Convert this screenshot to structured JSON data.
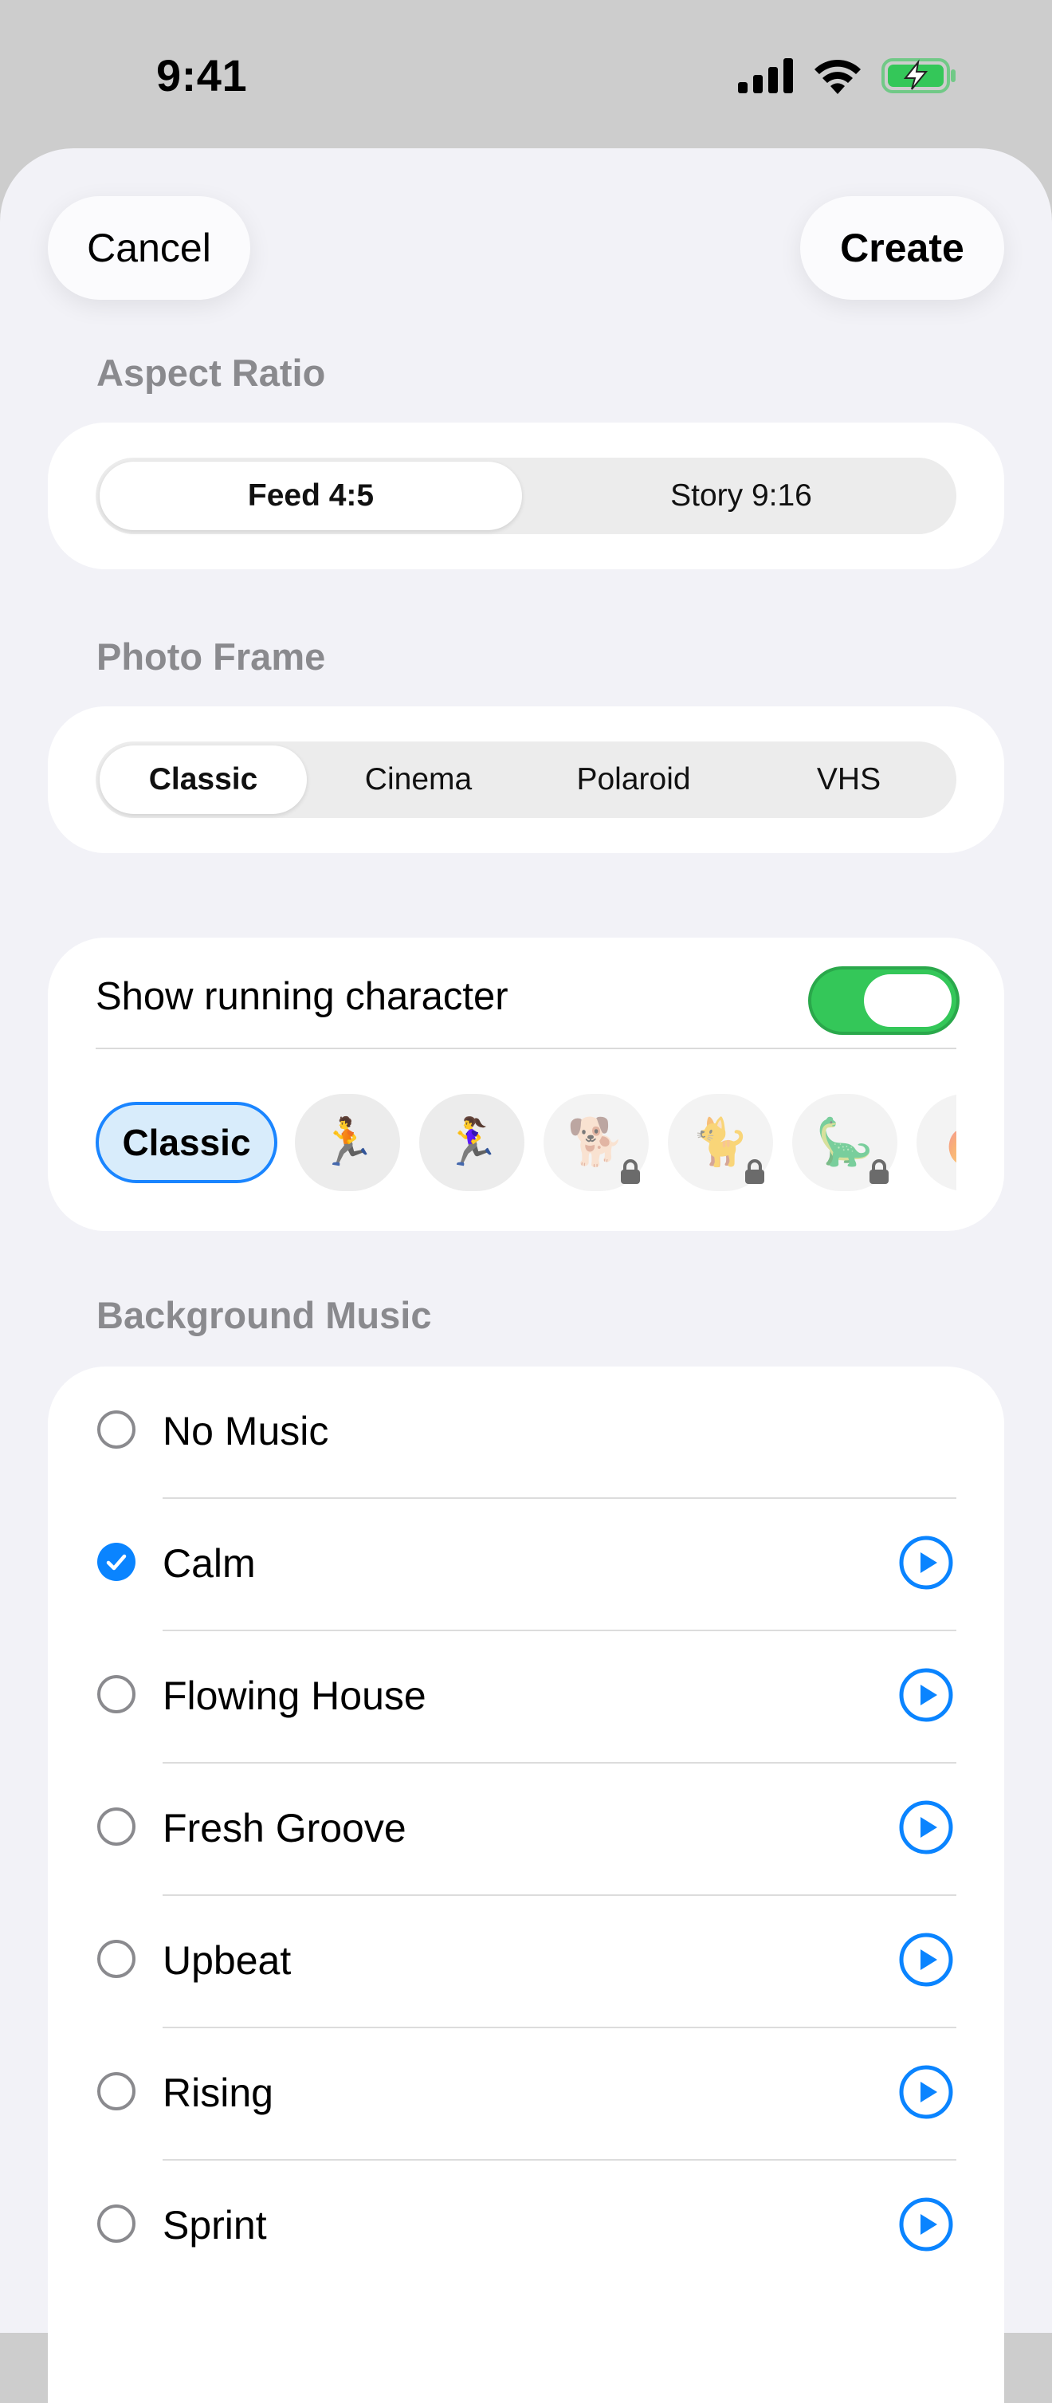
{
  "status_bar": {
    "time": "9:41"
  },
  "header": {
    "cancel_label": "Cancel",
    "create_label": "Create"
  },
  "aspect_ratio": {
    "title": "Aspect Ratio",
    "options": [
      "Feed 4:5",
      "Story 9:16"
    ],
    "selected": "Feed 4:5"
  },
  "photo_frame": {
    "title": "Photo Frame",
    "options": [
      "Classic",
      "Cinema",
      "Polaroid",
      "VHS"
    ],
    "selected": "Classic"
  },
  "character": {
    "label": "Show running character",
    "enabled": true,
    "selected_chip": "Classic",
    "items": [
      {
        "icon": "man-running-icon",
        "glyph": "🏃",
        "locked": false
      },
      {
        "icon": "woman-running-icon",
        "glyph": "🏃‍♀️",
        "locked": false
      },
      {
        "icon": "dog-icon",
        "glyph": "🐕",
        "locked": true
      },
      {
        "icon": "cat-icon",
        "glyph": "🐈",
        "locked": true
      },
      {
        "icon": "dinosaur-icon",
        "glyph": "🦕",
        "locked": true
      },
      {
        "icon": "fire-icon",
        "glyph": "🔥",
        "locked": true
      }
    ]
  },
  "music": {
    "title": "Background Music",
    "items": [
      {
        "label": "No Music",
        "checked": false,
        "playable": false
      },
      {
        "label": "Calm",
        "checked": true,
        "playable": true
      },
      {
        "label": "Flowing House",
        "checked": false,
        "playable": true
      },
      {
        "label": "Fresh Groove",
        "checked": false,
        "playable": true
      },
      {
        "label": "Upbeat",
        "checked": false,
        "playable": true
      },
      {
        "label": "Rising",
        "checked": false,
        "playable": true
      },
      {
        "label": "Sprint",
        "checked": false,
        "playable": true
      }
    ]
  },
  "colors": {
    "accent": "#0a84ff",
    "toggle_on": "#34c759",
    "section_title": "#8a8a8e"
  }
}
